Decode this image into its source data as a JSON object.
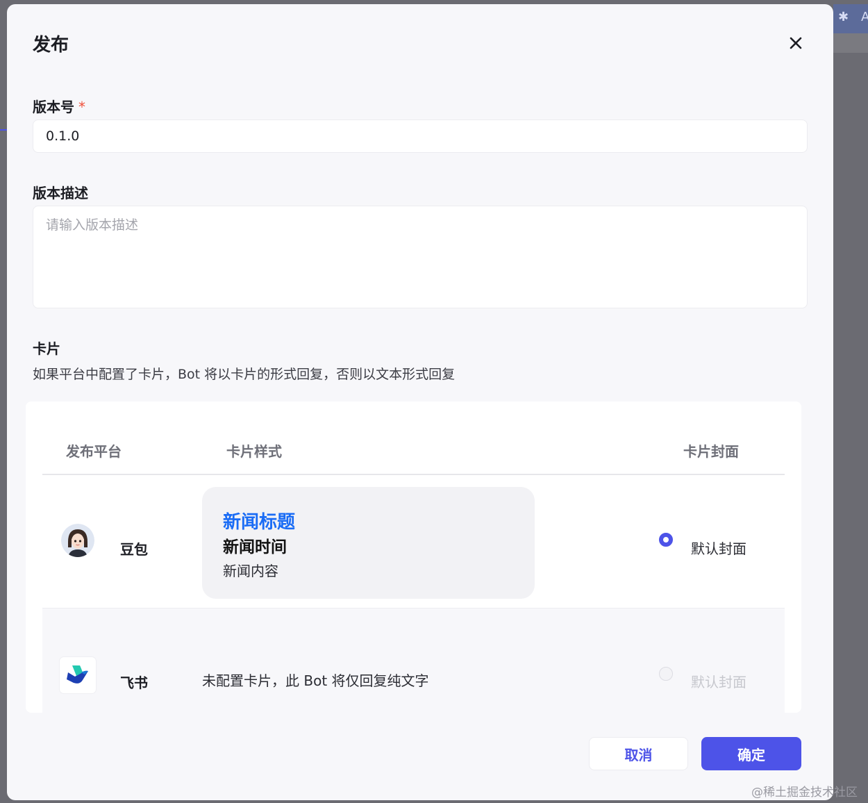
{
  "dialog": {
    "title": "发布"
  },
  "version": {
    "label": "版本号",
    "required_mark": "*",
    "value": "0.1.0"
  },
  "description": {
    "label": "版本描述",
    "placeholder": "请输入版本描述",
    "value": ""
  },
  "card_section": {
    "title": "卡片",
    "hint": "如果平台中配置了卡片，Bot 将以卡片的形式回复，否则以文本形式回复"
  },
  "table": {
    "columns": [
      "发布平台",
      "卡片样式",
      "卡片封面"
    ],
    "rows": [
      {
        "platform": "豆包",
        "card_preview": {
          "title": "新闻标题",
          "time": "新闻时间",
          "content": "新闻内容"
        },
        "cover_option": "默认封面",
        "cover_selected": true,
        "cover_enabled": true
      },
      {
        "platform": "飞书",
        "card_note": "未配置卡片，此 Bot 将仅回复纯文字",
        "cover_option": "默认封面",
        "cover_selected": false,
        "cover_enabled": false
      }
    ]
  },
  "footer": {
    "cancel_label": "取消",
    "confirm_label": "确定"
  },
  "watermark": "@稀土掘金技术社区",
  "colors": {
    "accent": "#4d53e8",
    "preview_title": "#1a6cf5",
    "required": "#f0503a"
  },
  "icons": {
    "close": "close-icon",
    "background_toolbar": "puzzle-icon",
    "feishu": "feishu-logo-icon",
    "doubao": "doubao-avatar"
  }
}
